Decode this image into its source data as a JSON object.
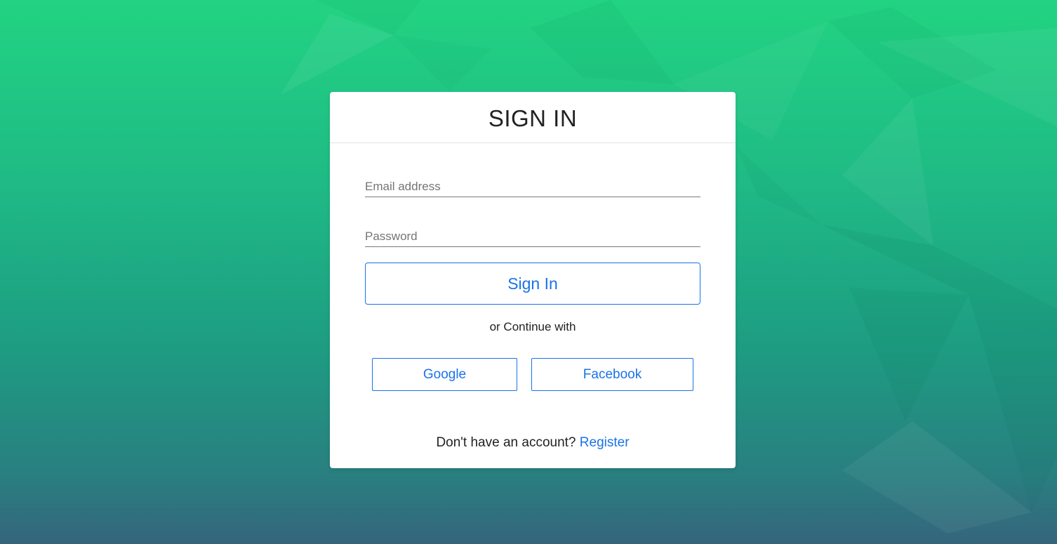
{
  "colors": {
    "accent": "#1a73e8",
    "background_top": "#22d382",
    "background_bottom": "#35657c",
    "card": "#ffffff"
  },
  "signin_card": {
    "title": "SIGN IN",
    "email_placeholder": "Email address",
    "password_placeholder": "Password",
    "submit_label": "Sign In",
    "continue_text": "or Continue with",
    "social": {
      "google_label": "Google",
      "facebook_label": "Facebook"
    },
    "footer": {
      "prompt": "Don't have an account?",
      "register_label": "Register"
    }
  }
}
